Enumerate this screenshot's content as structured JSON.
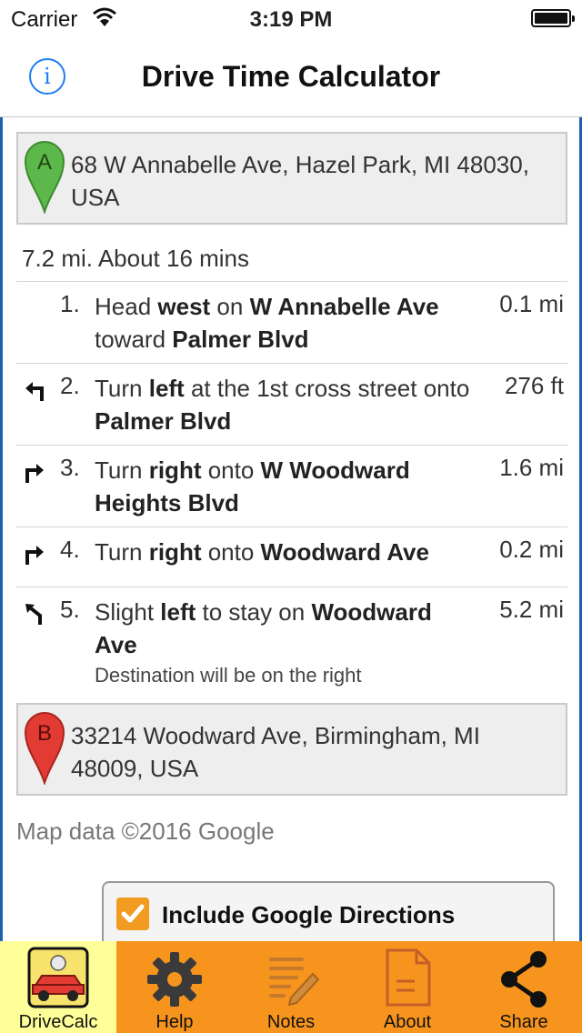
{
  "status": {
    "carrier": "Carrier",
    "time": "3:19 PM"
  },
  "nav": {
    "info_glyph": "i",
    "title": "Drive Time Calculator"
  },
  "origin": {
    "pin_label": "A",
    "address": "68 W Annabelle Ave, Hazel Park, MI 48030, USA",
    "pin_color": "#5cb84a"
  },
  "summary": "7.2 mi. About 16 mins",
  "steps": [
    {
      "num": "1.",
      "parts": [
        [
          "Head ",
          false
        ],
        [
          "west",
          true
        ],
        [
          " on ",
          false
        ],
        [
          "W Annabelle Ave",
          true
        ],
        [
          " toward ",
          false
        ],
        [
          "Palmer Blvd",
          true
        ]
      ],
      "dist": "0.1 mi",
      "turn": "none"
    },
    {
      "num": "2.",
      "parts": [
        [
          "Turn ",
          false
        ],
        [
          "left",
          true
        ],
        [
          " at the 1st cross street onto ",
          false
        ],
        [
          "Palmer Blvd",
          true
        ]
      ],
      "dist": "276 ft",
      "turn": "turn-left-icon"
    },
    {
      "num": "3.",
      "parts": [
        [
          "Turn ",
          false
        ],
        [
          "right",
          true
        ],
        [
          " onto ",
          false
        ],
        [
          "W Woodward Heights Blvd",
          true
        ]
      ],
      "dist": "1.6 mi",
      "turn": "turn-right-icon"
    },
    {
      "num": "4.",
      "parts": [
        [
          "Turn ",
          false
        ],
        [
          "right",
          true
        ],
        [
          " onto ",
          false
        ],
        [
          "Woodward Ave",
          true
        ]
      ],
      "dist": "0.2 mi",
      "turn": "turn-right-icon"
    },
    {
      "num": "5.",
      "parts": [
        [
          "Slight ",
          false
        ],
        [
          "left",
          true
        ],
        [
          " to stay on ",
          false
        ],
        [
          "Woodward Ave",
          true
        ]
      ],
      "sub": "Destination will be on the right",
      "dist": "5.2 mi",
      "turn": "slight-left-icon"
    }
  ],
  "destination": {
    "pin_label": "B",
    "address": "33214 Woodward Ave, Birmingham, MI 48009, USA",
    "pin_color": "#e23b34"
  },
  "map_attribution": "Map data ©2016 Google",
  "google_directions": {
    "label": "Include Google Directions",
    "checked": true
  },
  "tabs": [
    {
      "label": "DriveCalc",
      "icon": "drivecalc-car-icon",
      "active": true
    },
    {
      "label": "Help",
      "icon": "gear-icon",
      "active": false
    },
    {
      "label": "Notes",
      "icon": "notes-icon",
      "active": false
    },
    {
      "label": "About",
      "icon": "document-icon",
      "active": false
    },
    {
      "label": "Share",
      "icon": "share-icon",
      "active": false
    }
  ],
  "colors": {
    "accent": "#1f7ef0",
    "tabbar": "#f7941d",
    "tab_active": "#ffff99",
    "checkbox": "#f29b21"
  }
}
